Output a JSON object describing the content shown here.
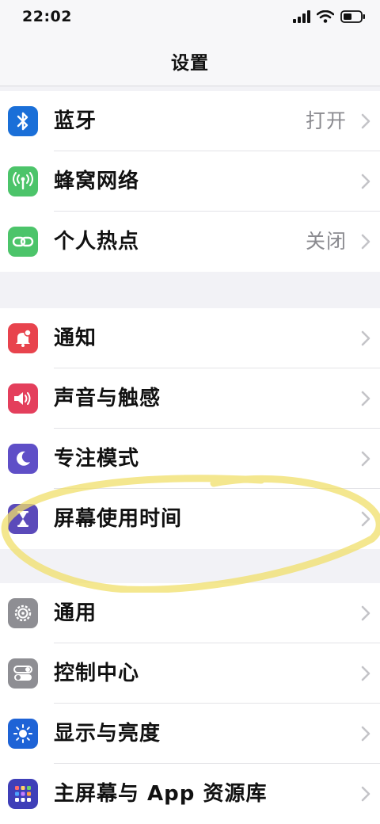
{
  "status_bar": {
    "time": "22:02",
    "signal_icon": "cellular-signal-icon",
    "wifi_icon": "wifi-icon",
    "battery_icon": "battery-icon"
  },
  "nav": {
    "title": "设置"
  },
  "groups": [
    {
      "items": [
        {
          "label": "蓝牙",
          "value": "打开",
          "icon": "bluetooth-icon",
          "color": "#1a6fd8"
        },
        {
          "label": "蜂窝网络",
          "value": "",
          "icon": "antenna-icon",
          "color": "#4cc46a"
        },
        {
          "label": "个人热点",
          "value": "关闭",
          "icon": "link-icon",
          "color": "#4cc46a"
        }
      ]
    },
    {
      "items": [
        {
          "label": "通知",
          "value": "",
          "icon": "bell-icon",
          "color": "#e8434d"
        },
        {
          "label": "声音与触感",
          "value": "",
          "icon": "speaker-icon",
          "color": "#e43f5c"
        },
        {
          "label": "专注模式",
          "value": "",
          "icon": "moon-icon",
          "color": "#5f4fc7"
        },
        {
          "label": "屏幕使用时间",
          "value": "",
          "icon": "hourglass-icon",
          "color": "#5b4aba"
        }
      ]
    },
    {
      "items": [
        {
          "label": "通用",
          "value": "",
          "icon": "gear-icon",
          "color": "#8e8e93"
        },
        {
          "label": "控制中心",
          "value": "",
          "icon": "toggles-icon",
          "color": "#8e8e93"
        },
        {
          "label": "显示与亮度",
          "value": "",
          "icon": "sun-icon",
          "color": "#1e63d6"
        },
        {
          "label": "主屏幕与 App 资源库",
          "value": "",
          "icon": "app-grid-icon",
          "color": "#3f3fb8"
        }
      ]
    }
  ],
  "annotation": {
    "type": "yellow-marker-circle",
    "color": "#f0df6a"
  }
}
